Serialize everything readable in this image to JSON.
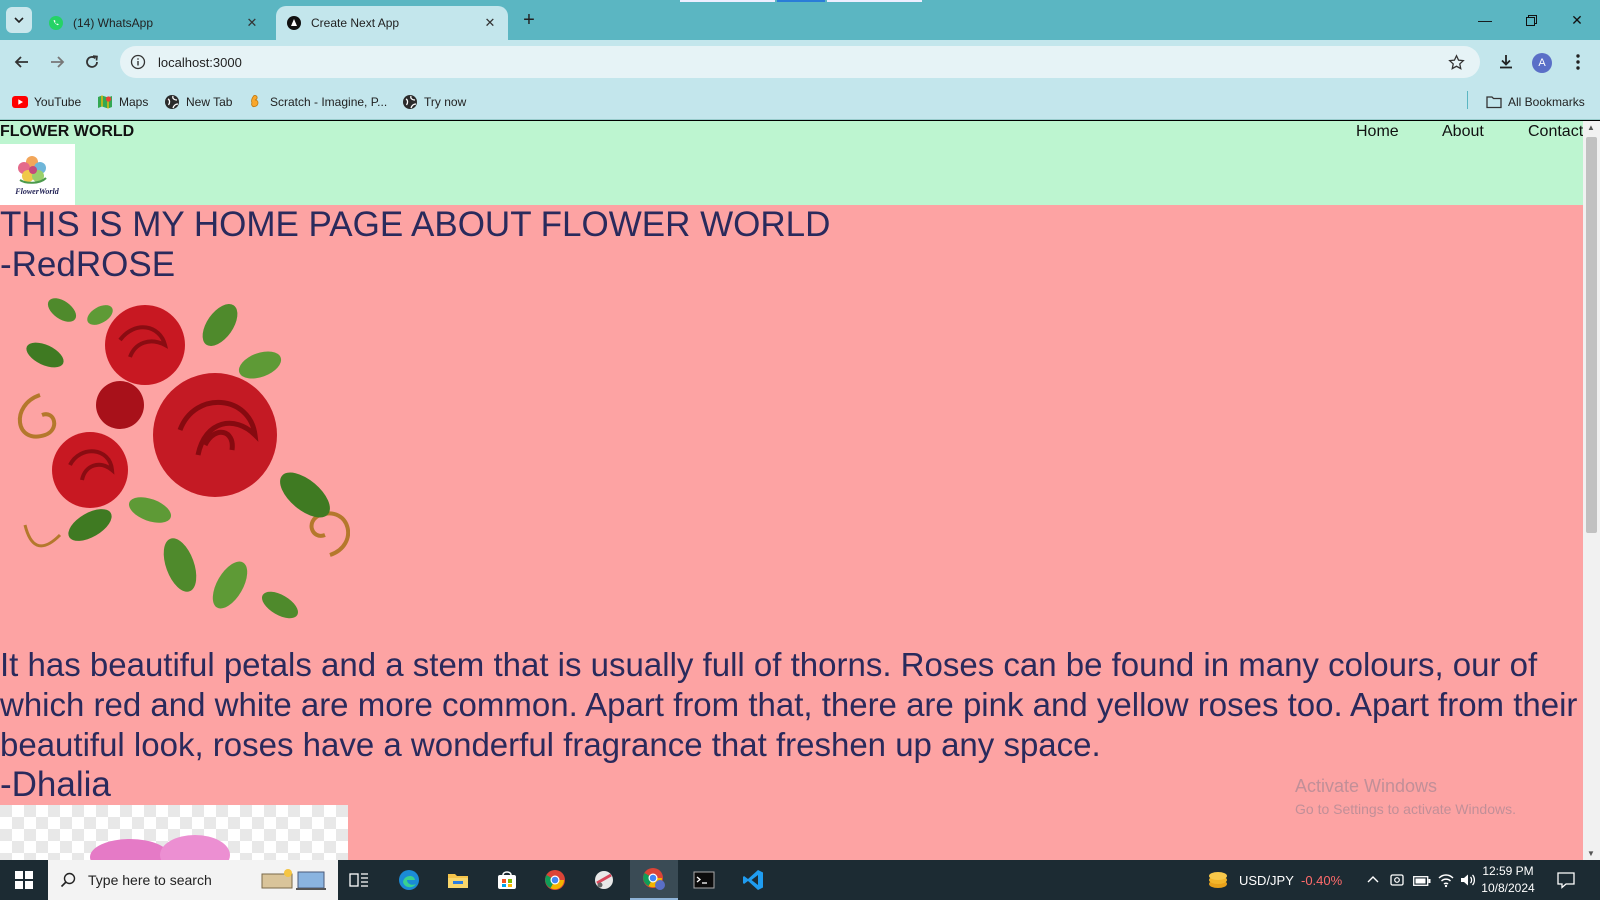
{
  "browser": {
    "tabs": [
      {
        "label": "(14) WhatsApp",
        "icon": "whatsapp-icon",
        "active": false
      },
      {
        "label": "Create Next App",
        "icon": "nextjs-icon",
        "active": true
      }
    ],
    "address": "localhost:3000",
    "profile_initial": "A",
    "bookmarks": [
      {
        "label": "YouTube",
        "icon": "youtube-icon"
      },
      {
        "label": "Maps",
        "icon": "maps-icon"
      },
      {
        "label": "New Tab",
        "icon": "globe-icon"
      },
      {
        "label": "Scratch - Imagine, P...",
        "icon": "scratch-icon"
      },
      {
        "label": "Try now",
        "icon": "globe-icon"
      }
    ],
    "all_bookmarks_label": "All Bookmarks"
  },
  "site": {
    "brand": "FLOWER WORLD",
    "logo_text": "FlowerWorld",
    "nav": [
      "Home",
      "About",
      "Contact"
    ],
    "heading": "THIS IS MY HOME PAGE ABOUT FLOWER WORLD",
    "flower1_title": "-RedROSE",
    "flower1_desc": "It has beautiful petals and a stem that is usually full of thorns. Roses can be found in many colours, our of which red and white are more common. Apart from that, there are pink and yellow roses too. Apart from their beautiful look, roses have a wonderful fragrance that freshen up any space.",
    "flower2_title": "-Dhalia",
    "colors": {
      "header_bg": "#bdf5d0",
      "page_bg": "#fda3a3",
      "text": "#2a2a5c"
    }
  },
  "watermark": {
    "title": "Activate Windows",
    "subtitle": "Go to Settings to activate Windows."
  },
  "taskbar": {
    "search_placeholder": "Type here to search",
    "ticker_symbol": "USD/JPY",
    "ticker_change": "-0.40%",
    "time": "12:59 PM",
    "date": "10/8/2024"
  }
}
